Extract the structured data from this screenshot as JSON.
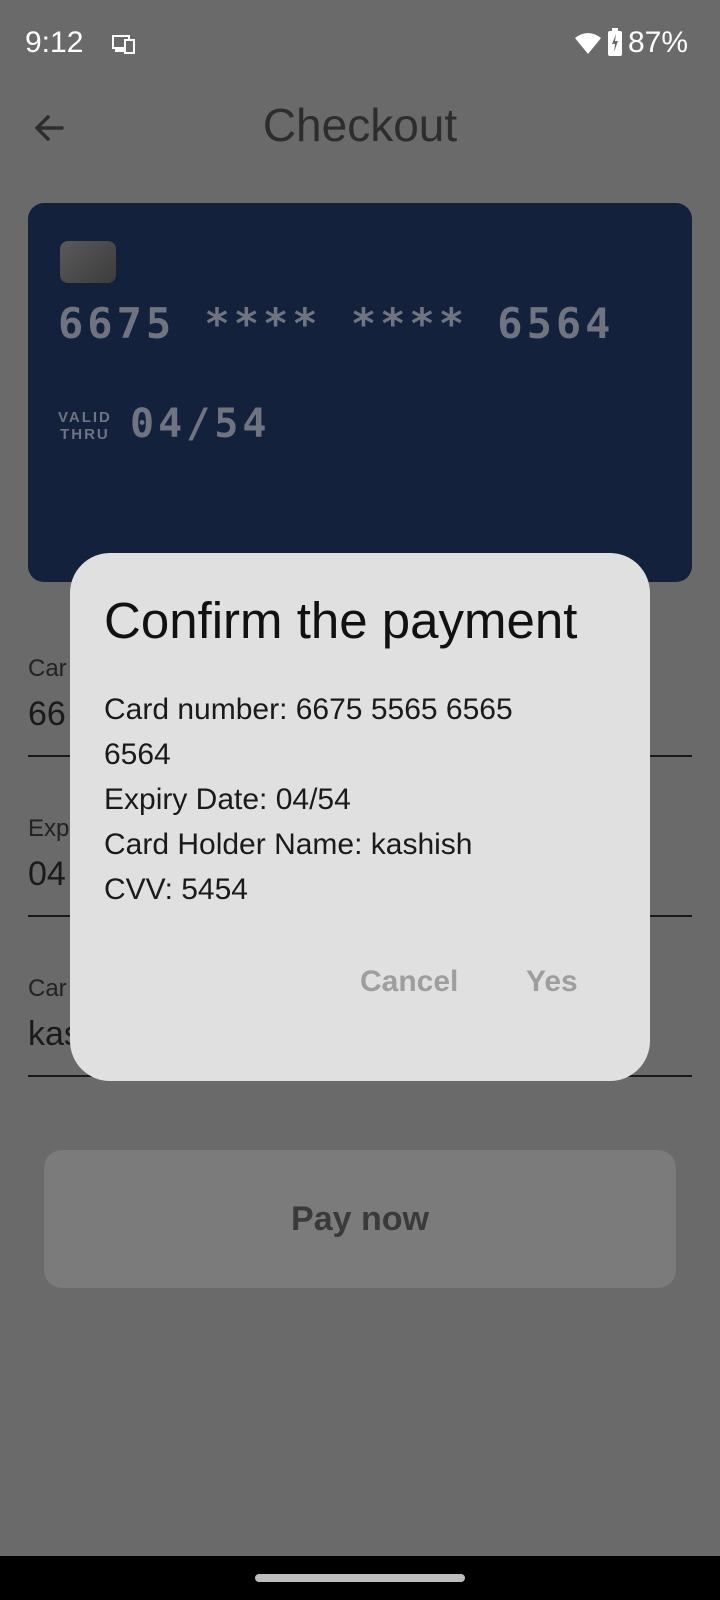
{
  "status_bar": {
    "time": "9:12",
    "battery": "87%",
    "icons": [
      "cast-icon",
      "wifi-icon",
      "battery-icon"
    ]
  },
  "app_bar": {
    "title": "Checkout",
    "back_icon": "arrow-back-icon"
  },
  "credit_card": {
    "number": "6675 **** **** 6564",
    "valid_label_line1": "VALID",
    "valid_label_line2": "THRU",
    "expiry": "04/54",
    "background_color": "#13213d"
  },
  "form": {
    "card_number": {
      "label": "Car",
      "value": "66"
    },
    "expiry": {
      "label": "Exp",
      "value": "04"
    },
    "holder": {
      "label": "Car",
      "value": "kas"
    }
  },
  "pay_button": {
    "label": "Pay now"
  },
  "dialog": {
    "title": "Confirm the payment",
    "lines": [
      "Card number: 6675 5565 6565",
      "6564",
      "Expiry Date: 04/54",
      "Card Holder Name: kashish",
      "CVV: 5454"
    ],
    "cancel_label": "Cancel",
    "yes_label": "Yes"
  }
}
